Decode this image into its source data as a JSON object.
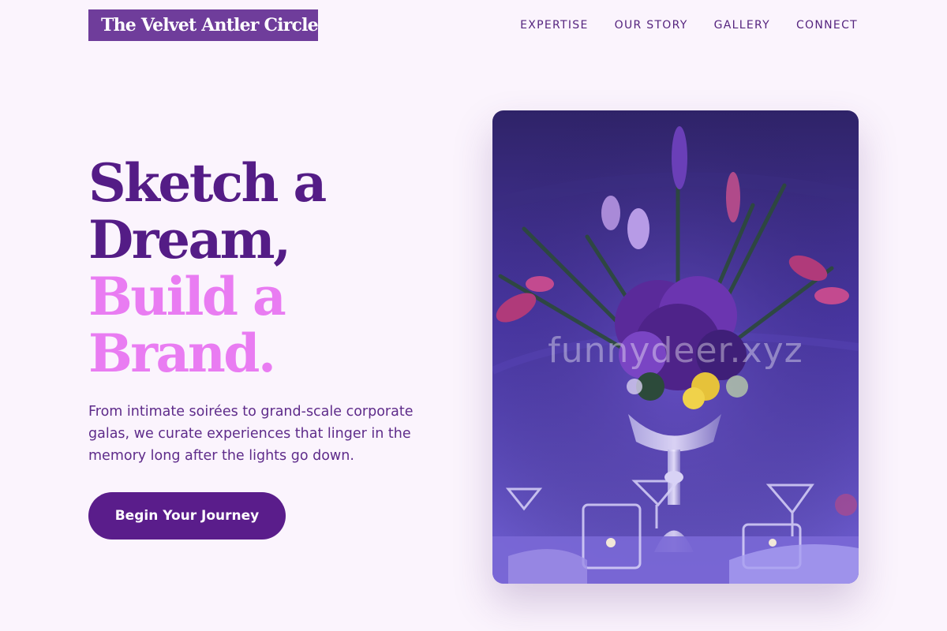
{
  "brand": {
    "name": "The Velvet Antler Circle"
  },
  "nav": {
    "items": [
      {
        "label": "EXPERTISE"
      },
      {
        "label": "OUR STORY"
      },
      {
        "label": "GALLERY"
      },
      {
        "label": "CONNECT"
      }
    ]
  },
  "hero": {
    "headline": {
      "line1": "Sketch a",
      "line2": "Dream,",
      "line3": "Build a",
      "line4": "Brand."
    },
    "description": "From intimate soirées to grand-scale corporate galas, we curate experiences that linger in the memory long after the lights go down.",
    "cta_label": "Begin Your Journey"
  },
  "image": {
    "watermark": "funnydeer.xyz"
  },
  "colors": {
    "background": "#fbf4fd",
    "brand_purple": "#6f3d9b",
    "deep_purple": "#541c86",
    "accent_pink": "#e97cf2",
    "button_purple": "#5a1d8b"
  }
}
